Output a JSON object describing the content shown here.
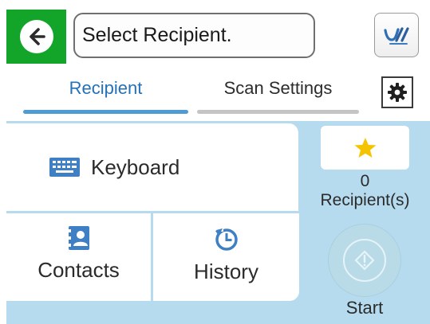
{
  "header": {
    "back_icon": "back-arrow-icon",
    "prompt": "Select Recipient.",
    "logo_icon": "scanner-brand-logo-icon",
    "colors": {
      "back_bg": "#13a42a",
      "prompt_border": "#6f6f6f"
    }
  },
  "tabs": [
    {
      "label": "Recipient",
      "active": true
    },
    {
      "label": "Scan Settings",
      "active": false
    }
  ],
  "settings_icon": "gear-icon",
  "options": {
    "keyboard": {
      "label": "Keyboard",
      "icon": "keyboard-icon"
    },
    "contacts": {
      "label": "Contacts",
      "icon": "contacts-icon"
    },
    "history": {
      "label": "History",
      "icon": "history-clock-icon"
    }
  },
  "side": {
    "favorite_icon": "star-icon",
    "recipient_count": "0",
    "recipient_label": "Recipient(s)",
    "start_label": "Start",
    "start_icon": "start-diamond-icon"
  },
  "colors": {
    "accent": "#2471b8",
    "active_underline": "#4e9cd2",
    "panel_bg": "#b6dbef",
    "star": "#f5c400"
  }
}
